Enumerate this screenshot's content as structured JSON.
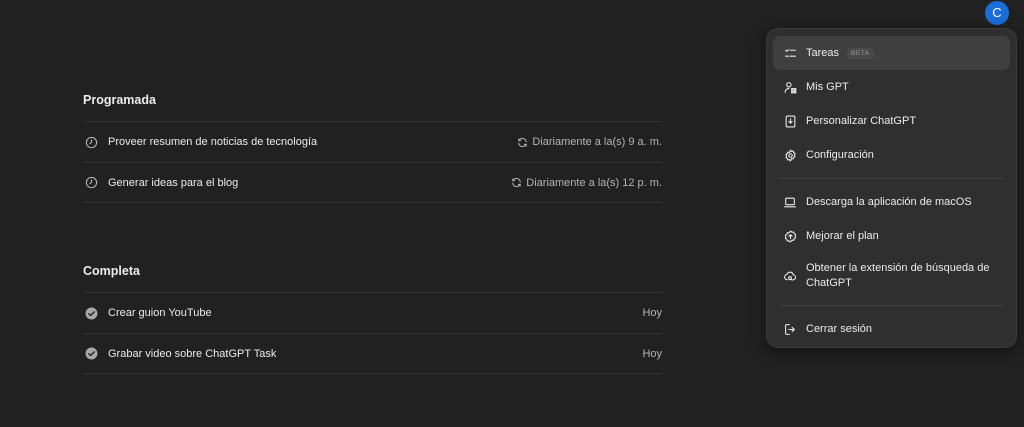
{
  "avatar": {
    "initial": "C",
    "color": "#1a6ed8"
  },
  "programada": {
    "title": "Programada",
    "tasks": [
      {
        "label": "Proveer resumen de noticias de tecnología",
        "schedule": "Diariamente a la(s) 9 a. m.",
        "icon": "clock-icon",
        "meta_icon": "repeat-icon"
      },
      {
        "label": "Generar ideas para el blog",
        "schedule": "Diariamente a la(s) 12 p. m.",
        "icon": "clock-icon",
        "meta_icon": "repeat-icon"
      }
    ]
  },
  "completa": {
    "title": "Completa",
    "tasks": [
      {
        "label": "Crear guion YouTube",
        "when": "Hoy",
        "icon": "check-circle-icon"
      },
      {
        "label": "Grabar video sobre ChatGPT Task",
        "when": "Hoy",
        "icon": "check-circle-icon"
      }
    ]
  },
  "menu": {
    "items": [
      {
        "label": "Tareas",
        "badge": "BETA",
        "icon": "tasks-icon"
      },
      {
        "label": "Mis GPT",
        "icon": "gpts-icon"
      },
      {
        "label": "Personalizar ChatGPT",
        "icon": "customize-icon"
      },
      {
        "label": "Configuración",
        "icon": "gear-icon"
      },
      {
        "label": "Descarga la aplicación de macOS",
        "icon": "laptop-icon"
      },
      {
        "label": "Mejorar el plan",
        "icon": "upgrade-icon"
      },
      {
        "label": "Obtener la extensión de búsqueda de ChatGPT",
        "icon": "extension-icon"
      },
      {
        "label": "Cerrar sesión",
        "icon": "logout-icon"
      }
    ]
  },
  "colors": {
    "background": "#212121",
    "menu_background": "#2f2f2f",
    "text": "#ececec",
    "muted_text": "#b4b4b4",
    "divider": "#333333"
  }
}
